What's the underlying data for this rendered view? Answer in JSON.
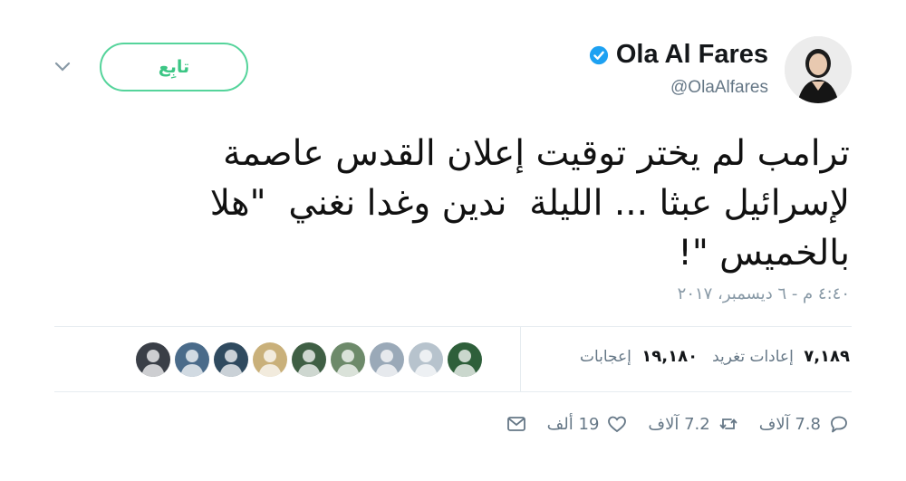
{
  "user": {
    "display_name": "Ola Al Fares",
    "handle": "@OlaAlfares",
    "verified": true
  },
  "follow_button": {
    "label": "تابِع"
  },
  "tweet": {
    "lines": [
      "ترامب لم يختر توقيت إعلان القدس عاصمة",
      "لإسرائيل عبثا ... الليلة  ندين وغدا نغني  \"هلا",
      "بالخميس \"!"
    ],
    "timestamp": "٤:٤٠ م - ٦ ديسمبر، ٢٠١٧"
  },
  "stats": {
    "retweets_count": "٧,١٨٩",
    "retweets_label": "إعادات تغريد",
    "likes_count": "١٩,١٨٠",
    "likes_label": "إعجابات"
  },
  "actions": {
    "reply": "7.8 آلاف",
    "retweet": "7.2 آلاف",
    "like": "19 ألف"
  },
  "liker_avatars": [
    {
      "color": "#3a3f47"
    },
    {
      "color": "#4a6b8a"
    },
    {
      "color": "#2f4a5f"
    },
    {
      "color": "#c9b07a"
    },
    {
      "color": "#3f5f44"
    },
    {
      "color": "#6d8a6a"
    },
    {
      "color": "#9aa9b8"
    },
    {
      "color": "#b7c3cd"
    },
    {
      "color": "#2e5f3a"
    }
  ],
  "colors": {
    "accent_green": "#55d49b",
    "verified_blue": "#1da1f2",
    "muted": "#657786"
  }
}
